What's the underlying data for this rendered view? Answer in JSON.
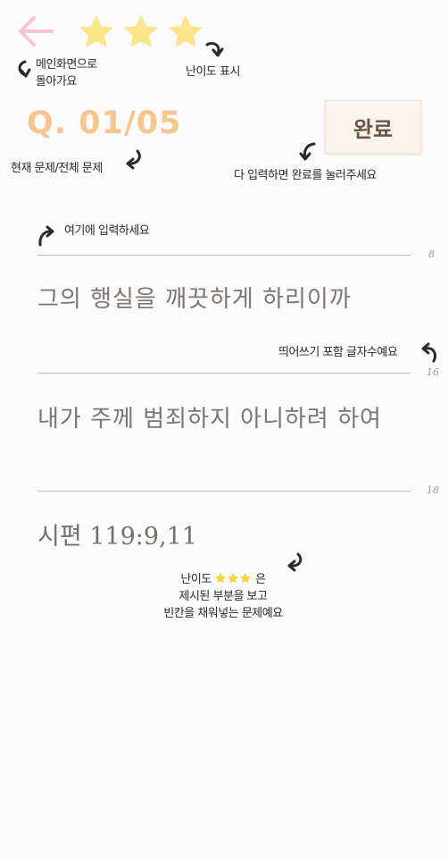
{
  "header": {
    "back_icon": "arrow-left-icon",
    "back_color": "#f7c6cf",
    "difficulty_stars": 3,
    "star_color": "#fde68a"
  },
  "annotations": {
    "back_note_line1": "메인화면으로",
    "back_note_line2": "돌아가요",
    "difficulty_note": "난이도 표시",
    "progress_note": "현재 문제/전체 문제",
    "done_note": "다 입력하면 완료를 눌러주세요",
    "input_note": "여기에 입력하세요",
    "count_note": "띄어쓰기 포함 글자수예요",
    "bottom_note_prefix": "난이도",
    "bottom_note_suffix": "은",
    "bottom_note_line2": "제시된 부분을 보고",
    "bottom_note_line3": "빈칸을 채워넣는 문제예요"
  },
  "question": {
    "number": "Q. 01/05",
    "number_color": "#f6c68d"
  },
  "done_button": {
    "label": "완료"
  },
  "lines": [
    {
      "count": "8",
      "text": "그의 행실을 깨끗하게 하리이까"
    },
    {
      "count": "16",
      "text": "내가 주께 범죄하지 아니하려 하여"
    },
    {
      "count": "18",
      "text": ""
    }
  ],
  "reference": "시편 119:9,11"
}
